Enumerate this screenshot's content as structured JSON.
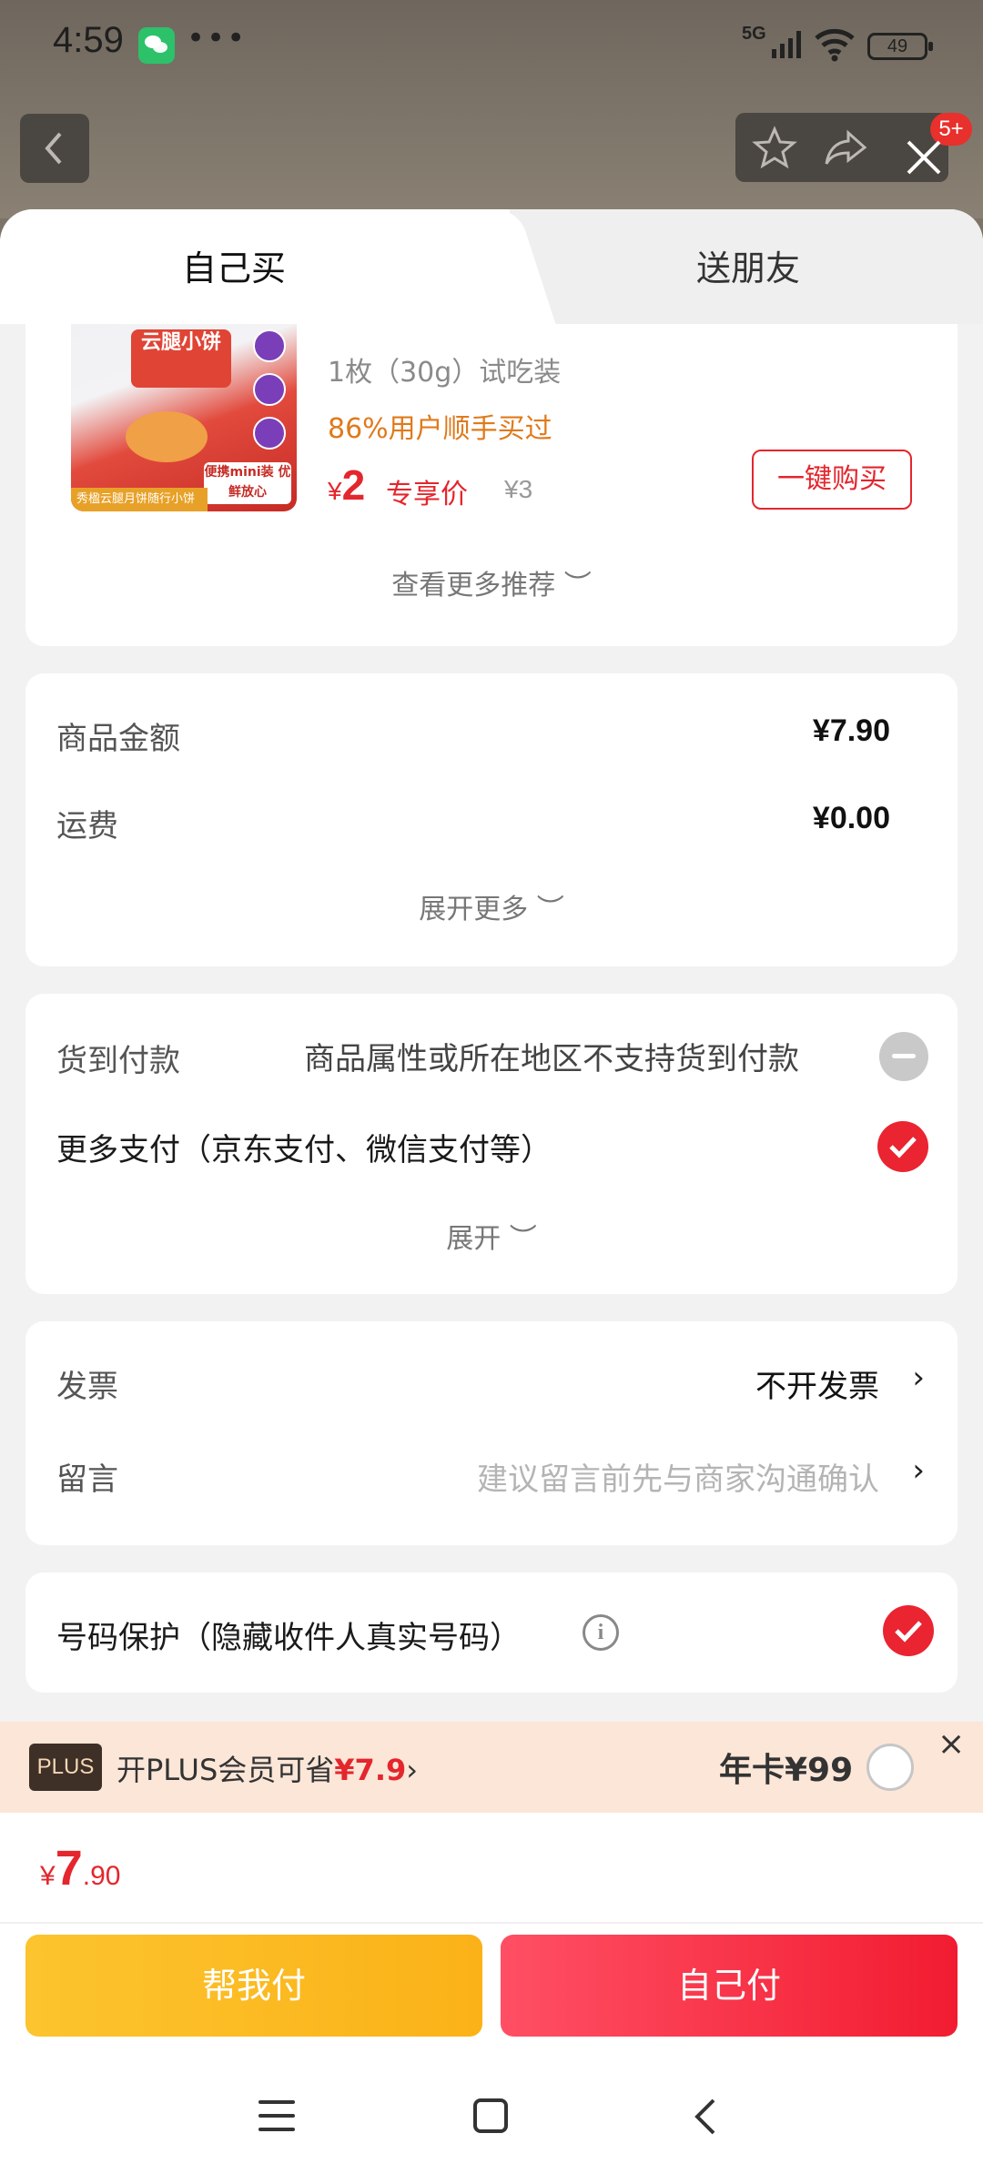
{
  "status_bar": {
    "time": "4:59",
    "network": "5G",
    "battery": "49",
    "more_dots": "•••"
  },
  "top_actions": {
    "badge": "5+"
  },
  "tabs": [
    {
      "label": "自己买",
      "active": true
    },
    {
      "label": "送朋友",
      "active": false
    }
  ],
  "recommend": {
    "image_texts": {
      "brand": "云腿小饼",
      "tag": "便携mini装 优鲜放心",
      "strip": "秀楹云腿月饼随行小饼"
    },
    "spec": "1枚（30g）试吃装",
    "bought": "86%用户顺手买过",
    "currency": "¥",
    "price": "2",
    "price_label": "专享价",
    "original_price": "¥3",
    "buy_button": "一键购买",
    "more": "查看更多推荐 ︶"
  },
  "amounts": {
    "goods_label": "商品金额",
    "goods_value": "¥7.90",
    "shipping_label": "运费",
    "shipping_value": "¥0.00",
    "expand": "展开更多 ︶"
  },
  "payment": {
    "cod_label": "货到付款",
    "cod_note": "商品属性或所在地区不支持货到付款",
    "more_label": "更多支付（京东支付、微信支付等）",
    "expand": "展开 ︶"
  },
  "invoice": {
    "label": "发票",
    "value": "不开发票",
    "chevron": "›",
    "message_label": "留言",
    "message_placeholder": "建议留言前先与商家沟通确认"
  },
  "privacy": {
    "label": "号码保护（隐藏收件人真实号码）",
    "info": "i"
  },
  "plus": {
    "logo": "PLUS",
    "text_prefix": "开PLUS会员可省",
    "save_amount": "¥7.9",
    "chevron": "›",
    "annual": "年卡¥99",
    "close": "×"
  },
  "total": {
    "currency": "¥",
    "integer": "7",
    "decimal": ".90"
  },
  "pay_buttons": {
    "help": "帮我付",
    "self": "自己付"
  },
  "colors": {
    "accent_red": "#e4262d",
    "yellow": "#fcc42e",
    "check_red": "#ea2430"
  }
}
